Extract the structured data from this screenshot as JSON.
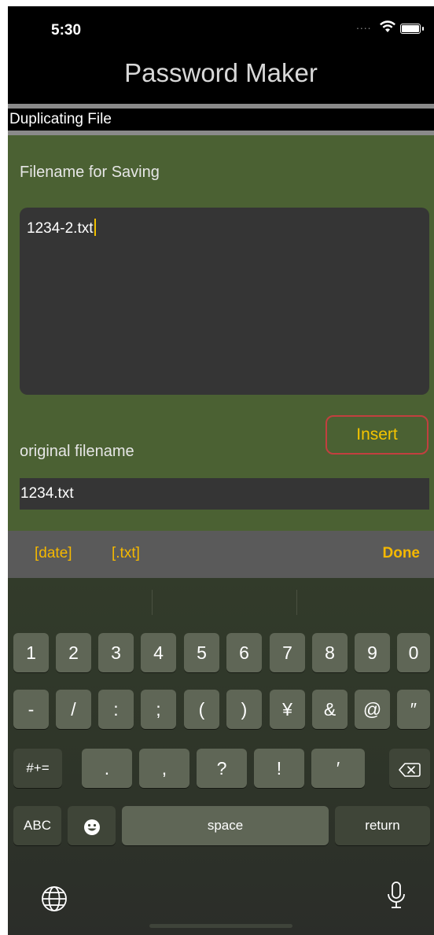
{
  "status_bar": {
    "time": "5:30"
  },
  "nav": {
    "title": "Password Maker"
  },
  "section": {
    "header": "Duplicating File"
  },
  "form": {
    "saving_label": "Filename for Saving",
    "saving_value": "1234-2.txt",
    "insert_label": "Insert",
    "original_label": "original filename",
    "original_value": "1234.txt"
  },
  "toolbar": {
    "date": "[date]",
    "txt": "[.txt]",
    "done": "Done"
  },
  "keyboard": {
    "row1": [
      "1",
      "2",
      "3",
      "4",
      "5",
      "6",
      "7",
      "8",
      "9",
      "0"
    ],
    "row2": [
      "-",
      "/",
      ":",
      ";",
      "(",
      ")",
      "¥",
      "&",
      "@",
      "″"
    ],
    "row3": [
      ".",
      ",",
      "?",
      "!",
      "′"
    ],
    "symbols_key": "#+=",
    "abc_key": "ABC",
    "space_key": "space",
    "return_key": "return"
  },
  "icons": {
    "wifi": "wifi-icon",
    "battery": "battery-icon",
    "delete": "delete-icon",
    "emoji": "emoji-icon",
    "globe": "globe-icon",
    "mic": "microphone-icon"
  },
  "colors": {
    "accent_yellow": "#f5b800",
    "insert_border": "#c23f3f",
    "panel_green": "#4b6133",
    "field_dark": "#353535"
  }
}
